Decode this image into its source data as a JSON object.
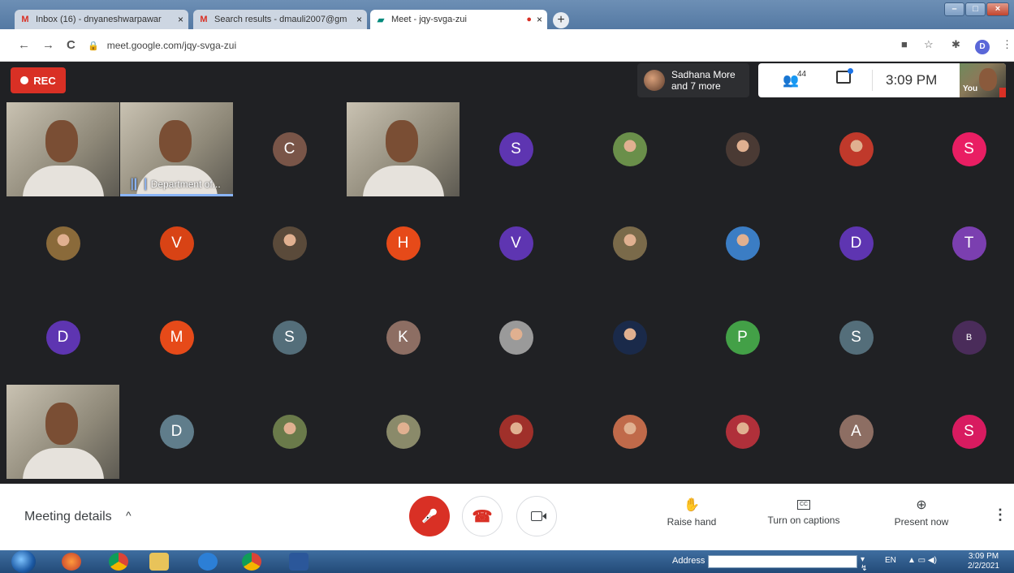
{
  "browser": {
    "tabs": [
      {
        "favicon": "gmail-icon",
        "fav_char": "M",
        "fav_color": "#d93025",
        "title": "Inbox (16) - dnyaneshwarpawar",
        "close": "×"
      },
      {
        "favicon": "gmail-icon",
        "fav_char": "M",
        "fav_color": "#d93025",
        "title": "Search results - dmauli2007@gm",
        "close": "×"
      },
      {
        "favicon": "meet-icon",
        "fav_char": "▰",
        "fav_color": "#00897b",
        "title": "Meet - jqy-svga-zui",
        "close": "×",
        "recording": "●"
      }
    ],
    "new_tab": "+",
    "window_controls": {
      "minimize": "–",
      "maximize": "□",
      "close": "×"
    },
    "nav": {
      "back": "←",
      "forward": "→",
      "reload": "C"
    },
    "lock": "🔒",
    "url": "meet.google.com/jqy-svga-zui",
    "extensions": [
      "■",
      "☆",
      "✱"
    ],
    "profile": "D",
    "menu": "⋮"
  },
  "meet_top": {
    "rec_label": "REC",
    "presenter_line1": "Sadhana More",
    "presenter_line2": "and 7 more",
    "people_icon": "👥",
    "people_count": "44",
    "time": "3:09 PM",
    "you_label": "You"
  },
  "participants": [
    {
      "kind": "video",
      "name": "video-participant-1"
    },
    {
      "kind": "video",
      "name": "video-participant-department",
      "label": "Department of...",
      "speaking": true
    },
    {
      "kind": "letter",
      "letter": "C",
      "color": "#795548"
    },
    {
      "kind": "video",
      "name": "video-participant-3"
    },
    {
      "kind": "letter",
      "letter": "S",
      "color": "#5e35b1"
    },
    {
      "kind": "photo",
      "color": "#6a8f4a"
    },
    {
      "kind": "photo",
      "color": "#4a3a34"
    },
    {
      "kind": "photo",
      "color": "#c0392b"
    },
    {
      "kind": "letter",
      "letter": "S",
      "color": "#e91e63"
    },
    {
      "kind": "photo",
      "color": "#8a6a3a"
    },
    {
      "kind": "letter",
      "letter": "V",
      "color": "#d84315"
    },
    {
      "kind": "photo",
      "color": "#5a4a3a"
    },
    {
      "kind": "letter",
      "letter": "H",
      "color": "#e64a19"
    },
    {
      "kind": "letter",
      "letter": "V",
      "color": "#5e35b1"
    },
    {
      "kind": "photo",
      "color": "#7a6a4a"
    },
    {
      "kind": "photo",
      "color": "#3b7dc4"
    },
    {
      "kind": "letter",
      "letter": "D",
      "color": "#5e35b1"
    },
    {
      "kind": "letter",
      "letter": "T",
      "color": "#7b3fb0"
    },
    {
      "kind": "letter",
      "letter": "D",
      "color": "#5e35b1"
    },
    {
      "kind": "letter",
      "letter": "M",
      "color": "#e64a19"
    },
    {
      "kind": "letter",
      "letter": "S",
      "color": "#546e7a"
    },
    {
      "kind": "letter",
      "letter": "K",
      "color": "#8d6e63"
    },
    {
      "kind": "photo",
      "color": "#9a9a9a"
    },
    {
      "kind": "photo",
      "color": "#1a2a4a"
    },
    {
      "kind": "letter",
      "letter": "P",
      "color": "#43a047"
    },
    {
      "kind": "letter",
      "letter": "S",
      "color": "#546e7a"
    },
    {
      "kind": "letter",
      "letter": "B",
      "color": "#4a2c5a",
      "small": true
    },
    {
      "kind": "video",
      "name": "video-participant-4"
    },
    {
      "kind": "letter",
      "letter": "D",
      "color": "#607d8b"
    },
    {
      "kind": "photo",
      "color": "#6a7a4a"
    },
    {
      "kind": "photo",
      "color": "#8a8a6a"
    },
    {
      "kind": "photo",
      "color": "#a0302a"
    },
    {
      "kind": "photo",
      "color": "#c06a4a"
    },
    {
      "kind": "photo",
      "color": "#b0303a"
    },
    {
      "kind": "letter",
      "letter": "A",
      "color": "#8d6e63"
    },
    {
      "kind": "letter",
      "letter": "S",
      "color": "#d81b60"
    }
  ],
  "bottom": {
    "meeting_details": "Meeting details",
    "chevron": "^",
    "mic_icon": "🎤",
    "end_icon": "☎",
    "raise_hand_icon": "✋",
    "raise_hand": "Raise hand",
    "captions_icon": "CC",
    "captions": "Turn on captions",
    "present_icon": "⊕",
    "present": "Present now",
    "more": "⋮"
  },
  "taskbar": {
    "address_label": "Address",
    "go": "▾ ↯",
    "lang": "EN",
    "tray": "▲ ▭ ◀)",
    "time": "3:09 PM",
    "date": "2/2/2021"
  }
}
